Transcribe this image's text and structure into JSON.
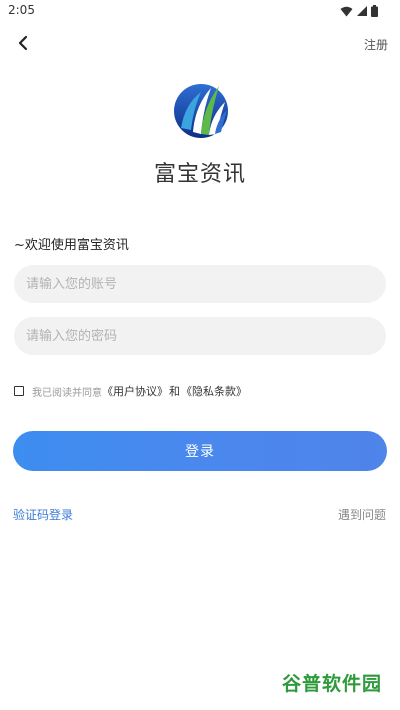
{
  "status_bar": {
    "time": "2:05"
  },
  "nav": {
    "register_label": "注册"
  },
  "app": {
    "name": "富宝资讯"
  },
  "form": {
    "welcome": "~欢迎使用富宝资讯",
    "account_placeholder": "请输入您的账号",
    "password_placeholder": "请输入您的密码",
    "agree_prefix": "我已阅读并同意",
    "user_agreement": "《用户协议》",
    "and": "和",
    "privacy_policy": "《隐私条款》",
    "login_label": "登录"
  },
  "links": {
    "sms_login": "验证码登录",
    "help": "遇到问题"
  },
  "watermark": {
    "text": "谷普软件园"
  },
  "colors": {
    "accent": "#4a88ee",
    "link": "#3a7bd5",
    "input_bg": "#f2f2f2",
    "watermark": "#2e9a3c"
  }
}
